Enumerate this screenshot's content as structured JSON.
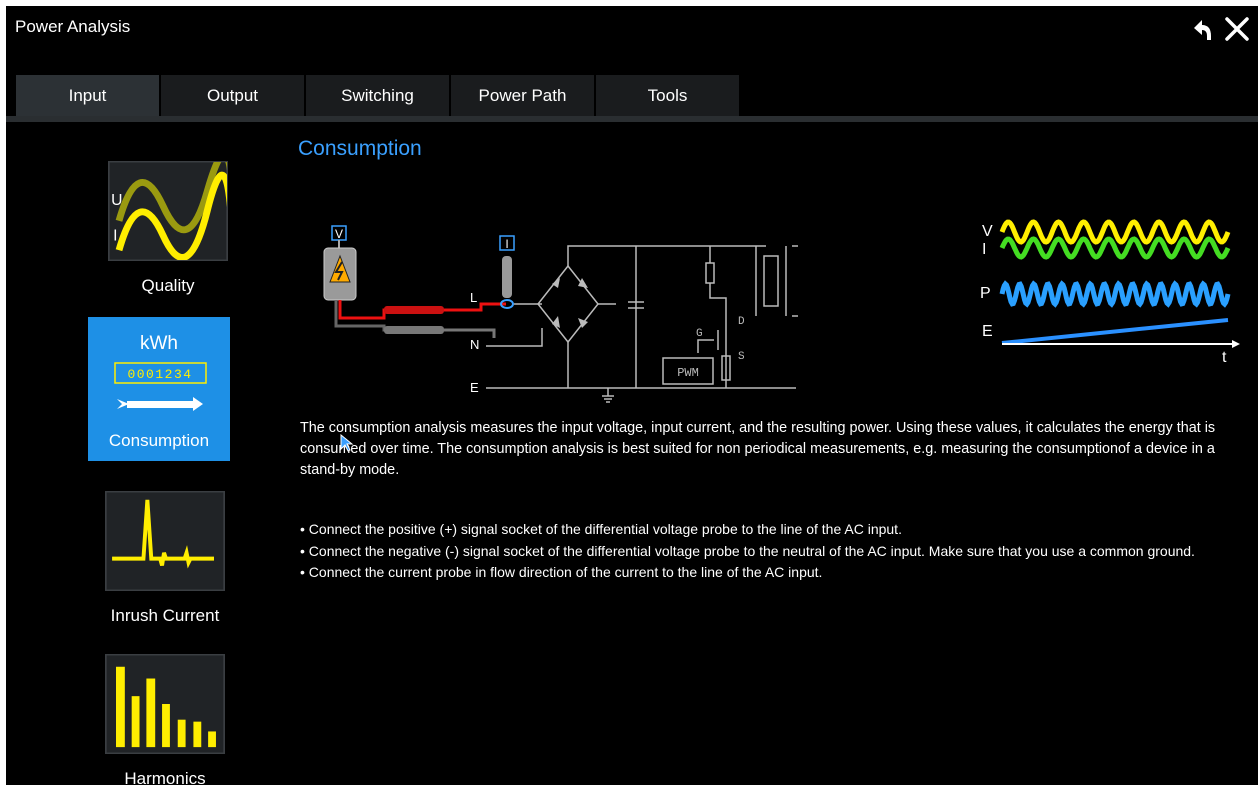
{
  "window": {
    "title": "Power Analysis"
  },
  "toolbar": {
    "back_icon": "undo-arrow-icon",
    "close_icon": "close-icon"
  },
  "tabs": [
    {
      "label": "Input",
      "active": true
    },
    {
      "label": "Output"
    },
    {
      "label": "Switching"
    },
    {
      "label": "Power Path"
    },
    {
      "label": "Tools"
    }
  ],
  "sidebar": {
    "items": [
      {
        "label": "Quality",
        "icon": "sine-wave-icon",
        "icon_labels": [
          "U",
          "I"
        ]
      },
      {
        "label": "Consumption",
        "icon": "energy-meter-icon",
        "active": true,
        "meter_unit": "kWh",
        "meter_digits": "0001234"
      },
      {
        "label": "Inrush Current",
        "icon": "inrush-spike-icon"
      },
      {
        "label": "Harmonics",
        "icon": "harmonics-bars-icon"
      }
    ]
  },
  "main": {
    "title": "Consumption",
    "diagram": {
      "probe_v": "V",
      "probe_i": "I",
      "line_label": "L",
      "neutral_label": "N",
      "earth_label": "E",
      "pwm_label": "PWM",
      "g_label": "G",
      "d_label": "D",
      "s_label": "S"
    },
    "waveform_labels": {
      "v": "V",
      "i": "I",
      "p": "P",
      "e": "E",
      "t": "t"
    },
    "description": "The consumption analysis measures the input voltage, input current, and the resulting power. Using these values, it calculates the energy that is consumed over time. The consumption analysis is best suited for non periodical measurements, e.g. measuring the consumptionof a device in a stand-by mode.",
    "bullets": [
      "• Connect the positive (+) signal socket of the differential voltage probe to the line of the AC input.",
      "• Connect the negative (-) signal socket of the differential voltage probe to the neutral of the AC input. Make sure that you use a common ground.",
      "• Connect the current probe in flow direction of the current to the line of the AC input."
    ]
  },
  "colors": {
    "accent": "#1e90e6",
    "title_blue": "#3aa0ff",
    "wave_yellow": "#ffee00",
    "wave_green": "#44dd22",
    "wave_blue": "#2aa0ff"
  }
}
